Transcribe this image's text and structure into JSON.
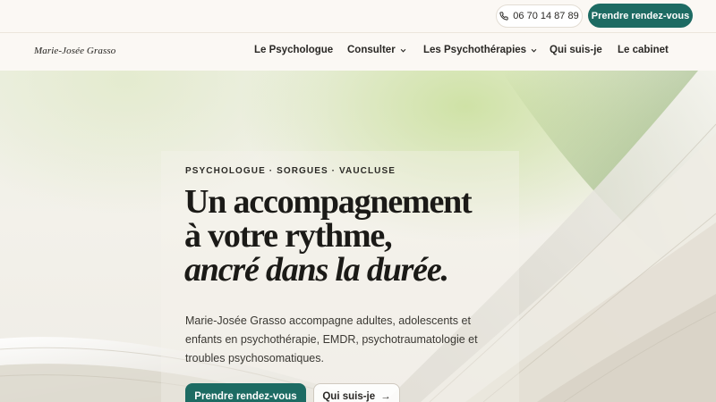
{
  "topbar": {
    "phone": "06 70 14 87 89",
    "phone_icon": "phone-icon",
    "cta": "Prendre rendez-vous"
  },
  "nav": {
    "brand": "Marie-Josée Grasso",
    "items": [
      {
        "label": "Le Psychologue",
        "has_dropdown": false
      },
      {
        "label": "Consulter",
        "has_dropdown": true
      },
      {
        "label": "Les Psychothérapies",
        "has_dropdown": true
      },
      {
        "label": "Qui suis-je",
        "has_dropdown": false
      },
      {
        "label": "Le cabinet",
        "has_dropdown": false
      }
    ]
  },
  "hero": {
    "eyebrow": "PSYCHOLOGUE · SORGUES · VAUCLUSE",
    "headline_line1": "Un accompagnement",
    "headline_line2": "à votre rythme,",
    "headline_line3": "ancré dans la durée.",
    "lede": "Marie-Josée Grasso accompagne adultes, adolescents et enfants en psychothérapie, EMDR, psychotraumatologie et troubles psychosomatiques.",
    "primary_cta": "Prendre rendez-vous",
    "secondary_cta": "Qui suis-je",
    "secondary_cta_icon": "arrow-right-icon"
  },
  "colors": {
    "accent": "#1d6b63",
    "background": "#fbf8f4",
    "text": "#1b1a17"
  }
}
